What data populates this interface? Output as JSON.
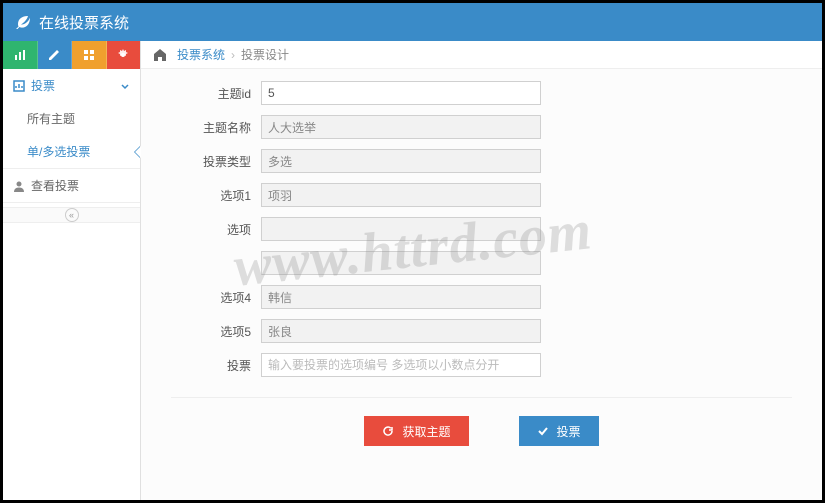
{
  "header": {
    "title": "在线投票系统"
  },
  "toolbar": {
    "items": [
      {
        "name": "stats",
        "color": "green"
      },
      {
        "name": "edit",
        "color": "blue"
      },
      {
        "name": "grid",
        "color": "orange"
      },
      {
        "name": "settings",
        "color": "red"
      }
    ]
  },
  "sidebar": {
    "group": {
      "label": "投票",
      "items": [
        "所有主题",
        "单/多选投票"
      ],
      "active_index": 1
    },
    "single": {
      "label": "查看投票"
    }
  },
  "breadcrumb": {
    "link": "投票系统",
    "current": "投票设计"
  },
  "form": {
    "topic_id": {
      "label": "主题id",
      "value": "5"
    },
    "topic_name": {
      "label": "主题名称",
      "value": "人大选举"
    },
    "vote_type": {
      "label": "投票类型",
      "value": "多选"
    },
    "option1": {
      "label": "选项1",
      "value": "项羽"
    },
    "option2": {
      "label": "选项",
      "value": ""
    },
    "option3": {
      "label": "",
      "value": ""
    },
    "option4": {
      "label": "选项4",
      "value": "韩信"
    },
    "option5": {
      "label": "选项5",
      "value": "张良"
    },
    "vote": {
      "label": "投票",
      "placeholder": "输入要投票的选项编号 多选项以小数点分开"
    }
  },
  "actions": {
    "fetch": "获取主题",
    "vote": "投票"
  },
  "watermark": "www.httrd.com"
}
